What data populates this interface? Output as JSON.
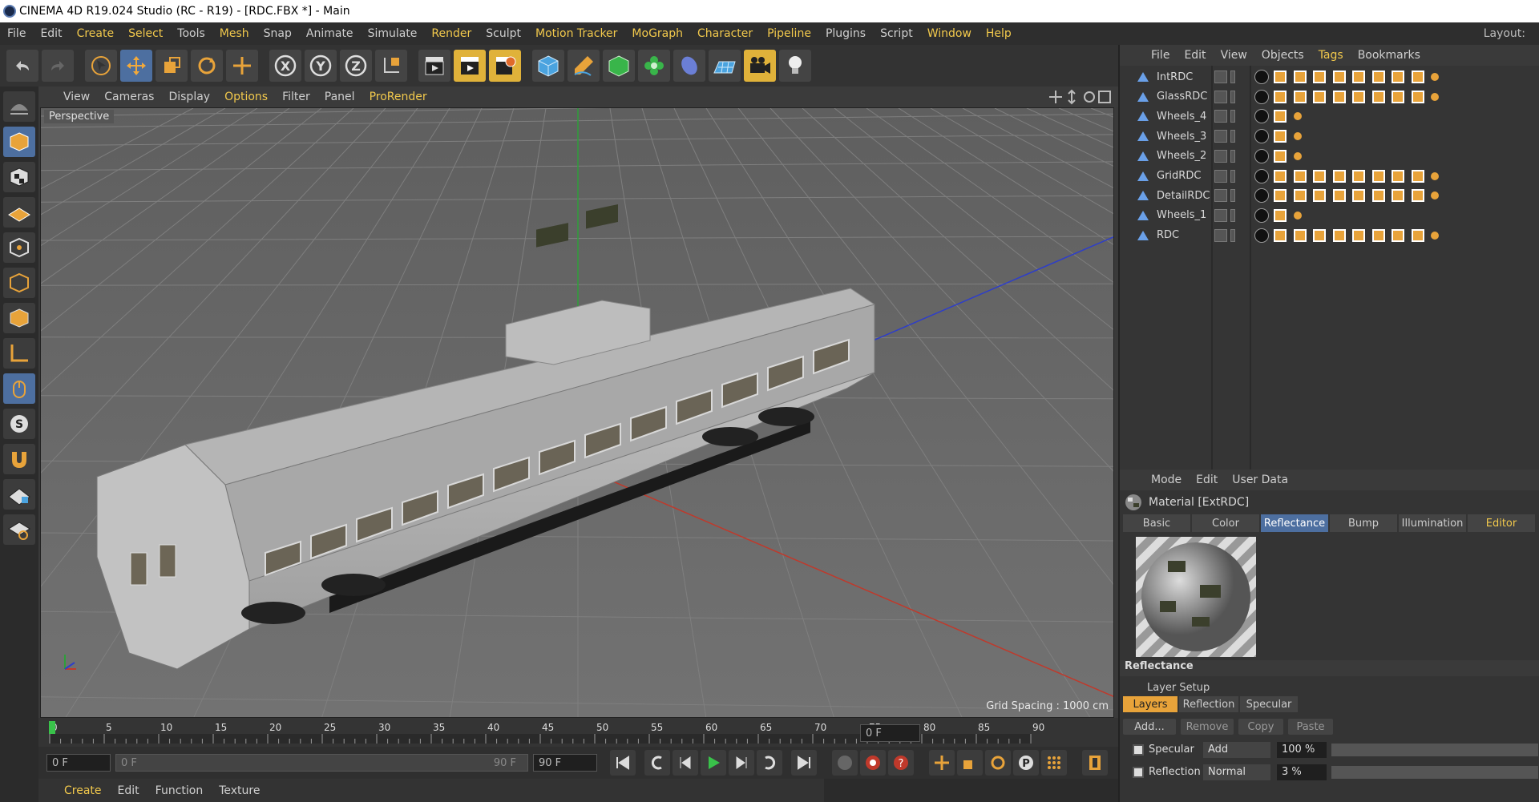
{
  "title": "CINEMA 4D R19.024 Studio (RC - R19) - [RDC.FBX *] - Main",
  "menu": [
    "File",
    "Edit",
    "Create",
    "Select",
    "Tools",
    "Mesh",
    "Snap",
    "Animate",
    "Simulate",
    "Render",
    "Sculpt",
    "Motion Tracker",
    "MoGraph",
    "Character",
    "Pipeline",
    "Plugins",
    "Script",
    "Window",
    "Help"
  ],
  "layout_label": "Layout:",
  "viewport": {
    "menu": [
      "View",
      "Cameras",
      "Display",
      "Options",
      "Filter",
      "Panel",
      "ProRender"
    ],
    "label": "Perspective",
    "grid_spacing": "Grid Spacing : 1000 cm"
  },
  "timeline": {
    "ticks": [
      "0",
      "5",
      "10",
      "15",
      "20",
      "25",
      "30",
      "35",
      "40",
      "45",
      "50",
      "55",
      "60",
      "65",
      "70",
      "75",
      "80",
      "85",
      "90"
    ],
    "current": "0 F",
    "start": "0 F",
    "range_start": "0 F",
    "range_end": "90 F",
    "end": "90 F"
  },
  "bottom_tabs": [
    "Create",
    "Edit",
    "Function",
    "Texture"
  ],
  "object_manager": {
    "menu": [
      "File",
      "Edit",
      "View",
      "Objects",
      "Tags",
      "Bookmarks"
    ],
    "objects": [
      {
        "name": "IntRDC",
        "materials": 8
      },
      {
        "name": "GlassRDC",
        "materials": 8
      },
      {
        "name": "Wheels_4",
        "materials": 1
      },
      {
        "name": "Wheels_3",
        "materials": 1
      },
      {
        "name": "Wheels_2",
        "materials": 1
      },
      {
        "name": "GridRDC",
        "materials": 8
      },
      {
        "name": "DetailRDC",
        "materials": 8
      },
      {
        "name": "Wheels_1",
        "materials": 1
      },
      {
        "name": "RDC",
        "materials": 8
      }
    ]
  },
  "attribute_manager": {
    "menu": [
      "Mode",
      "Edit",
      "User Data"
    ],
    "material_title": "Material [ExtRDC]",
    "tabs": [
      "Basic",
      "Color",
      "Reflectance",
      "Bump",
      "Illumination",
      "Editor"
    ],
    "active_tab": "Reflectance",
    "section": "Reflectance",
    "layer_setup": "Layer Setup",
    "layer_tabs": [
      "Layers",
      "Reflection",
      "Specular"
    ],
    "buttons": [
      "Add...",
      "Remove",
      "Copy",
      "Paste"
    ],
    "layers": [
      {
        "name": "Specular",
        "mode": "Add",
        "value": "100 %"
      },
      {
        "name": "Reflection",
        "mode": "Normal",
        "value": "3 %"
      }
    ]
  },
  "colors": {
    "accent": "#f2c94c",
    "selection": "#4d6fa0",
    "material_tag": "#e8a33a"
  }
}
